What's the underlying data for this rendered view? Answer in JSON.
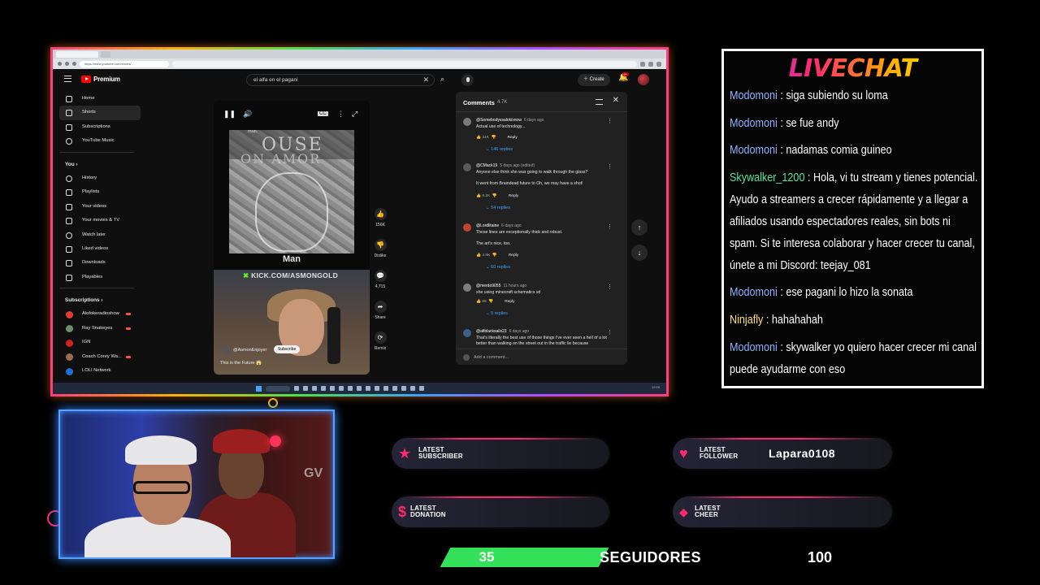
{
  "browser": {
    "address": "https://www.youtube.com/shorts/…"
  },
  "youtube": {
    "logo_text": "Premium",
    "search_value": "el alfa en el pagani",
    "create_label": "Create",
    "notification_badge": "9+",
    "sidebar": {
      "main": [
        "Home",
        "Shorts",
        "Subscriptions",
        "YouTube Music"
      ],
      "you_header": "You",
      "you": [
        "History",
        "Playlists",
        "Your videos",
        "Your movies & TV",
        "Watch later",
        "Liked videos",
        "Downloads",
        "Playables"
      ],
      "subs_header": "Subscriptions",
      "subscriptions": [
        {
          "name": "Alofokeradioshow",
          "color": "#e33b2e"
        },
        {
          "name": "Ray Snakeyes",
          "color": "#6b8f6a"
        },
        {
          "name": "IGN",
          "color": "#d32020"
        },
        {
          "name": "Coach Corey Wa...",
          "color": "#9a6e4e"
        },
        {
          "name": "LOLI Network",
          "color": "#1f6fd6"
        }
      ]
    },
    "short": {
      "cc_label": "CC",
      "frame_text_1": "OUSE",
      "frame_text_2": "ON AMOR",
      "small_label": "man.",
      "caption": "Man",
      "kick_banner": "KICK.COM/ASMONGOLD",
      "channel": "@AsmonEnjoyer",
      "subscribe": "Subscribe",
      "title": "This is the Future 😱"
    },
    "actions": [
      {
        "icon": "👍",
        "label": "156K"
      },
      {
        "icon": "👎",
        "label": "Dislike"
      },
      {
        "icon": "💬",
        "label": "4,715"
      },
      {
        "icon": "➦",
        "label": "Share"
      },
      {
        "icon": "⟳",
        "label": "Remix"
      }
    ],
    "comments": {
      "title": "Comments",
      "count": "4.7K",
      "add_placeholder": "Add a comment...",
      "items": [
        {
          "author": "@Somebodyssalokisnow",
          "time": "6 days ago",
          "text": "Actual use of technology...",
          "likes": "31K",
          "replies": "146 replies",
          "avatar": "#7a7a7a"
        },
        {
          "author": "@CMack19",
          "time": "5 days ago (edited)",
          "text": "Anyone else think she was going to walk through the glass?\n\nIt went from Braindead future to Oh, we may have a shot!",
          "likes": "8.2K",
          "replies": "54 replies",
          "avatar": "#5a5a5a"
        },
        {
          "author": "@Lordlitaine",
          "time": "6 days ago",
          "text": "Those lines are exceptionally thick and robust.\n\nThe art's nice, too.",
          "likes": "4.9K",
          "replies": "60 replies",
          "avatar": "#c2452d"
        },
        {
          "author": "@merdo9055",
          "time": "11 hours ago",
          "text": "she using minecraft schematics xd",
          "likes": "66",
          "replies": "5 replies",
          "avatar": "#7d7d7d"
        },
        {
          "author": "@afiblacksails23",
          "time": "6 days ago",
          "text": "That's literally the best use of those things I've ever seen a hell of a lot better than walking on the street out in the traffic lie because",
          "likes": "",
          "replies": "",
          "avatar": "#3e5f8a"
        }
      ],
      "reply_label": "Reply"
    },
    "taskbar_clock": "12:00"
  },
  "livechat": {
    "title": "LIVECHAT",
    "messages": [
      {
        "user": "Modomoni",
        "color": "#8fb4ff",
        "text": "siga subiendo su loma"
      },
      {
        "user": "Modomoni",
        "color": "#8fb4ff",
        "text": "se fue andy"
      },
      {
        "user": "Modomoni",
        "color": "#8fb4ff",
        "text": "nadamas comia guineo"
      },
      {
        "user": "Skywalker_1200",
        "color": "#52e6a0",
        "text": "Hola, vi tu stream y tienes potencial. Ayudo a streamers a crecer rápidamente y a llegar a afiliados usando espectadores reales, sin bots ni spam. Si te interesa colaborar y hacer crecer tu canal, únete a mi Discord: teejay_081"
      },
      {
        "user": "Modomoni",
        "color": "#8fb4ff",
        "text": "ese pagani lo hizo la sonata"
      },
      {
        "user": "Ninjafly",
        "color": "#ffe27a",
        "text": "hahahahah"
      },
      {
        "user": "Modomoni",
        "color": "#8fb4ff",
        "text": "skywalker yo quiero hacer crecer mi canal puede ayudarme con eso"
      }
    ]
  },
  "widgets": {
    "subscriber": {
      "label_1": "LATEST",
      "label_2": "SUBSCRIBER",
      "value": ""
    },
    "follower": {
      "label_1": "LATEST",
      "label_2": "FOLLOWER",
      "value": "Lapara0108"
    },
    "donation": {
      "label_1": "LATEST",
      "label_2": "DONATION",
      "value": ""
    },
    "cheer": {
      "label_1": "LATEST",
      "label_2": "CHEER",
      "value": ""
    }
  },
  "webcam": {
    "sign_text": "GV"
  },
  "followers_goal": {
    "current": "35",
    "label": "SEGUIDORES",
    "target": "100"
  }
}
